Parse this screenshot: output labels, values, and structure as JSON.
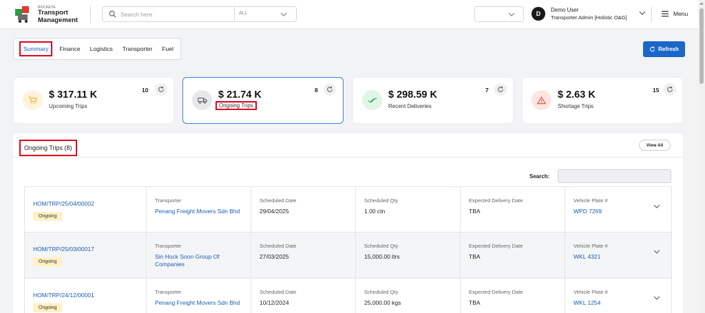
{
  "header": {
    "brand_small": "ROCKEYE",
    "brand_line1": "Transport",
    "brand_line2": "Management",
    "search_placeholder": "Search here",
    "search_scope": "ALL",
    "dropdown_value": "",
    "user_initial": "D",
    "user_name": "Demo User",
    "user_role": "Transporter Admin [Holistic O&G]",
    "menu_label": "Menu"
  },
  "tabs": [
    "Summary",
    "Finance",
    "Logistics",
    "Transporter",
    "Fuel"
  ],
  "refresh_label": "Refresh",
  "cards": [
    {
      "amount": "$ 317.11 K",
      "label": "Upcoming Trips",
      "count": "10",
      "icon": "cart-icon",
      "color": "#f2b233",
      "bg": "#fff3dc"
    },
    {
      "amount": "$ 21.74 K",
      "label": "Ongoing Trips",
      "count": "8",
      "icon": "truck-icon",
      "color": "#555555",
      "bg": "#e6e8ea"
    },
    {
      "amount": "$ 298.59 K",
      "label": "Recent Deliveries",
      "count": "7",
      "icon": "double-check-icon",
      "color": "#2fae5f",
      "bg": "#e1f5e8"
    },
    {
      "amount": "$ 2.63 K",
      "label": "Shortage Trips",
      "count": "15",
      "icon": "warning-icon",
      "color": "#e04a3a",
      "bg": "#fde5e2"
    }
  ],
  "panel": {
    "title": "Ongoing Trips (8)",
    "view_all": "View All",
    "search_label": "Search:",
    "search_value": ""
  },
  "columns": {
    "transporter": "Transporter",
    "scheduled_date": "Scheduled Date",
    "scheduled_qty": "Scheduled Qty",
    "expected_delivery": "Expected Delivery Date",
    "vehicle_plate": "Vehicle Plate #"
  },
  "trips": [
    {
      "id": "HOM/TRP/25/04/00002",
      "status": "Ongoing",
      "transporter": "Penang Freight Movers Sdn Bhd",
      "date": "29/04/2025",
      "qty": "1.00 ctn",
      "expected": "TBA",
      "plate": "WPD 7269"
    },
    {
      "id": "HOM/TRP/25/03/00017",
      "status": "Ongoing",
      "transporter": "Sin Hock Soon Group Of Companies",
      "date": "27/03/2025",
      "qty": "15,000.00 ltrs",
      "expected": "TBA",
      "plate": "WKL 4321"
    },
    {
      "id": "HOM/TRP/24/12/00001",
      "status": "Ongoing",
      "transporter": "Penang Freight Movers Sdn Bhd",
      "date": "10/12/2024",
      "qty": "25,000.00 kgs",
      "expected": "TBA",
      "plate": "WKL 1254"
    }
  ]
}
